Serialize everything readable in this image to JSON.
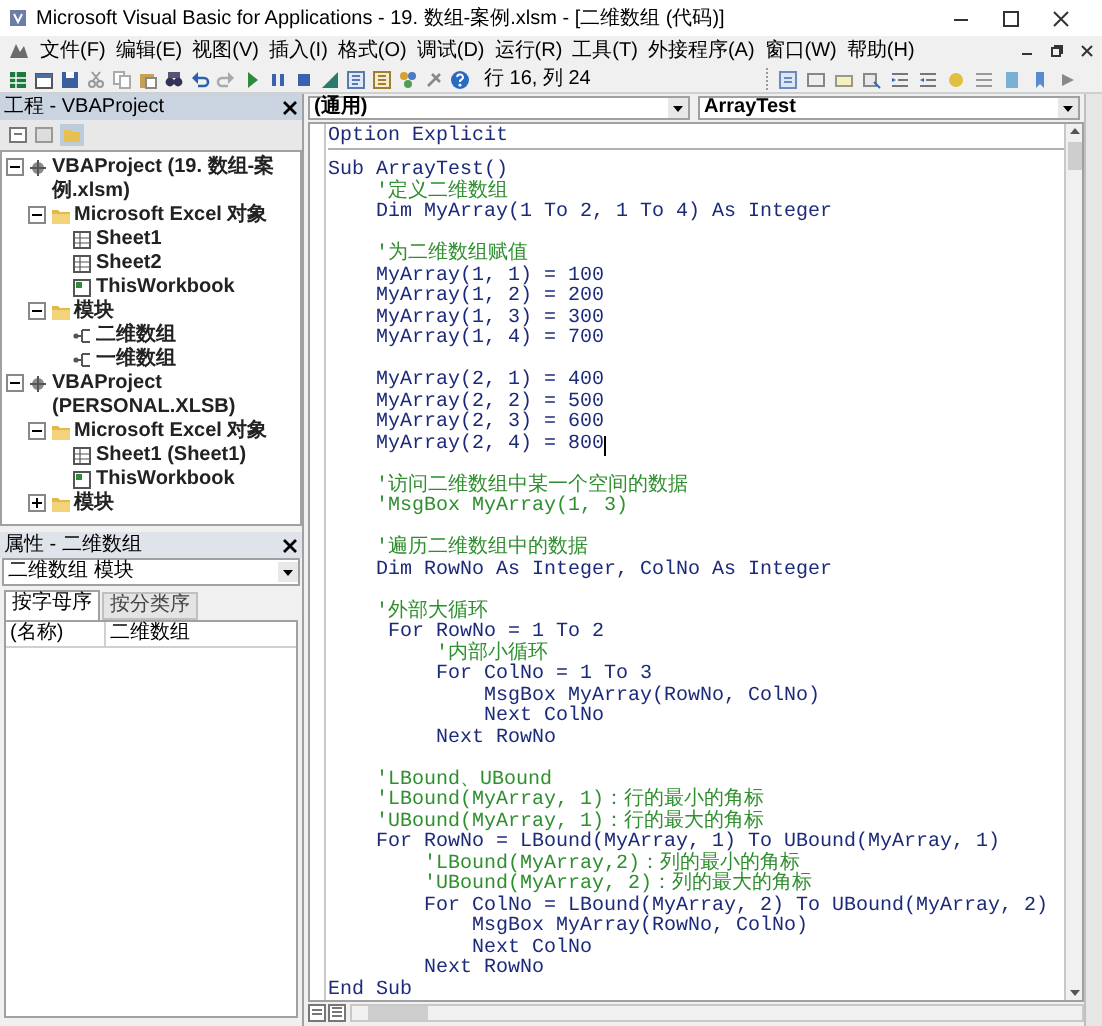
{
  "window": {
    "title": "Microsoft Visual Basic for Applications - 19. 数组-案例.xlsm - [二维数组 (代码)]"
  },
  "menu": [
    "文件(F)",
    "编辑(E)",
    "视图(V)",
    "插入(I)",
    "格式(O)",
    "调试(D)",
    "运行(R)",
    "工具(T)",
    "外接程序(A)",
    "窗口(W)",
    "帮助(H)"
  ],
  "toolbar": {
    "position": "行 16, 列 24"
  },
  "project_panel": {
    "title": "工程 - VBAProject",
    "tree": [
      {
        "kind": "project",
        "label": "VBAProject (19. 数组-案例.xlsm)",
        "expanded": true,
        "children": [
          {
            "kind": "folder",
            "label": "Microsoft Excel 对象",
            "expanded": true,
            "children": [
              {
                "kind": "sheet",
                "label": "Sheet1"
              },
              {
                "kind": "sheet",
                "label": "Sheet2"
              },
              {
                "kind": "workbook",
                "label": "ThisWorkbook"
              }
            ]
          },
          {
            "kind": "folder",
            "label": "模块",
            "expanded": true,
            "children": [
              {
                "kind": "module",
                "label": "二维数组"
              },
              {
                "kind": "module",
                "label": "一维数组"
              }
            ]
          }
        ]
      },
      {
        "kind": "project",
        "label": "VBAProject (PERSONAL.XLSB)",
        "expanded": true,
        "children": [
          {
            "kind": "folder",
            "label": "Microsoft Excel 对象",
            "expanded": true,
            "children": [
              {
                "kind": "sheet",
                "label": "Sheet1 (Sheet1)"
              },
              {
                "kind": "workbook",
                "label": "ThisWorkbook"
              }
            ]
          },
          {
            "kind": "folder",
            "label": "模块",
            "expanded": false
          }
        ]
      }
    ]
  },
  "properties_panel": {
    "title": "属性 - 二维数组",
    "object": "二维数组 模块",
    "tabs": [
      {
        "label": "按字母序",
        "selected": true
      },
      {
        "label": "按分类序",
        "selected": false
      }
    ],
    "rows": [
      {
        "name": "(名称)",
        "value": "二维数组"
      }
    ]
  },
  "code_window": {
    "object": "(通用)",
    "procedure": "ArrayTest",
    "declarations": "Option Explicit",
    "lines": [
      {
        "kind": "code",
        "text": "Sub ArrayTest()"
      },
      {
        "kind": "comment",
        "text": "    '定义二维数组"
      },
      {
        "kind": "code",
        "text": "    Dim MyArray(1 To 2, 1 To 4) As Integer"
      },
      {
        "kind": "blank"
      },
      {
        "kind": "comment",
        "text": "    '为二维数组赋值"
      },
      {
        "kind": "code",
        "text": "    MyArray(1, 1) = 100"
      },
      {
        "kind": "code",
        "text": "    MyArray(1, 2) = 200"
      },
      {
        "kind": "code",
        "text": "    MyArray(1, 3) = 300"
      },
      {
        "kind": "code",
        "text": "    MyArray(1, 4) = 700"
      },
      {
        "kind": "blank"
      },
      {
        "kind": "code",
        "text": "    MyArray(2, 1) = 400"
      },
      {
        "kind": "code",
        "text": "    MyArray(2, 2) = 500"
      },
      {
        "kind": "code",
        "text": "    MyArray(2, 3) = 600"
      },
      {
        "kind": "code",
        "text": "    MyArray(2, 4) = 800",
        "caret": true
      },
      {
        "kind": "blank"
      },
      {
        "kind": "comment",
        "text": "    '访问二维数组中某一个空间的数据"
      },
      {
        "kind": "comment",
        "text": "    'MsgBox MyArray(1, 3)"
      },
      {
        "kind": "blank"
      },
      {
        "kind": "comment",
        "text": "    '遍历二维数组中的数据"
      },
      {
        "kind": "code",
        "text": "    Dim RowNo As Integer, ColNo As Integer"
      },
      {
        "kind": "blank"
      },
      {
        "kind": "comment",
        "text": "    '外部大循环"
      },
      {
        "kind": "code",
        "text": "     For RowNo = 1 To 2"
      },
      {
        "kind": "comment",
        "text": "         '内部小循环"
      },
      {
        "kind": "code",
        "text": "         For ColNo = 1 To 3"
      },
      {
        "kind": "code",
        "text": "             MsgBox MyArray(RowNo, ColNo)"
      },
      {
        "kind": "code",
        "text": "             Next ColNo"
      },
      {
        "kind": "code",
        "text": "         Next RowNo"
      },
      {
        "kind": "blank"
      },
      {
        "kind": "comment",
        "text": "    'LBound、UBound"
      },
      {
        "kind": "comment",
        "text": "    'LBound(MyArray, 1)：行的最小的角标"
      },
      {
        "kind": "comment",
        "text": "    'UBound(MyArray, 1)：行的最大的角标"
      },
      {
        "kind": "code",
        "text": "    For RowNo = LBound(MyArray, 1) To UBound(MyArray, 1)"
      },
      {
        "kind": "comment",
        "text": "        'LBound(MyArray,2)：列的最小的角标"
      },
      {
        "kind": "comment",
        "text": "        'UBound(MyArray, 2)：列的最大的角标"
      },
      {
        "kind": "code",
        "text": "        For ColNo = LBound(MyArray, 2) To UBound(MyArray, 2)"
      },
      {
        "kind": "code",
        "text": "            MsgBox MyArray(RowNo, ColNo)"
      },
      {
        "kind": "code",
        "text": "            Next ColNo"
      },
      {
        "kind": "code",
        "text": "        Next RowNo"
      },
      {
        "kind": "code",
        "text": "End Sub"
      }
    ]
  }
}
